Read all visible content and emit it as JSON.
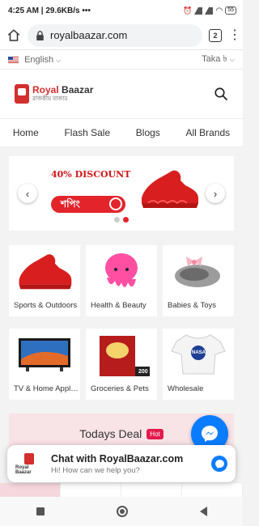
{
  "status_bar": {
    "time_speed": "4:25 AM | 29.6KB/s",
    "dots": "•••",
    "battery": "55"
  },
  "browser": {
    "url": "royalbaazar.com",
    "tab_count": "2",
    "menu": "⋮"
  },
  "lang_bar": {
    "language": "English",
    "currency": "Taka ৳"
  },
  "logo": {
    "name_a": "Royal",
    "name_b": " Baazar",
    "subtitle": "রাজকীয় বাজার"
  },
  "nav": [
    "Home",
    "Flash Sale",
    "Blogs",
    "All Brands"
  ],
  "banner": {
    "discount": "40% DISCOUNT",
    "shop_label": "শপিং"
  },
  "categories": [
    {
      "label": "Sports & Outdoors",
      "icon": "red-sneaker"
    },
    {
      "label": "Health & Beauty",
      "icon": "pink-octopus-toy"
    },
    {
      "label": "Babies & Toys",
      "icon": "baby-shoe"
    },
    {
      "label": "TV & Home Appliances",
      "icon": "television"
    },
    {
      "label": "Groceries & Pets",
      "icon": "tea-box",
      "badge": "200"
    },
    {
      "label": "Wholesale",
      "icon": "nasa-tshirt",
      "tshirt_text": "NASA"
    }
  ],
  "deal": {
    "title": "Todays Deal",
    "badge": "Hot"
  },
  "chat": {
    "title": "Chat with RoyalBaazar.com",
    "subtitle": "Hi! How can we help you?",
    "mini_logo": "Royal Baazar"
  },
  "colors": {
    "brand_red": "#e3242b",
    "messenger_blue": "#0a7cff",
    "deal_bg": "#f8e3e7"
  }
}
